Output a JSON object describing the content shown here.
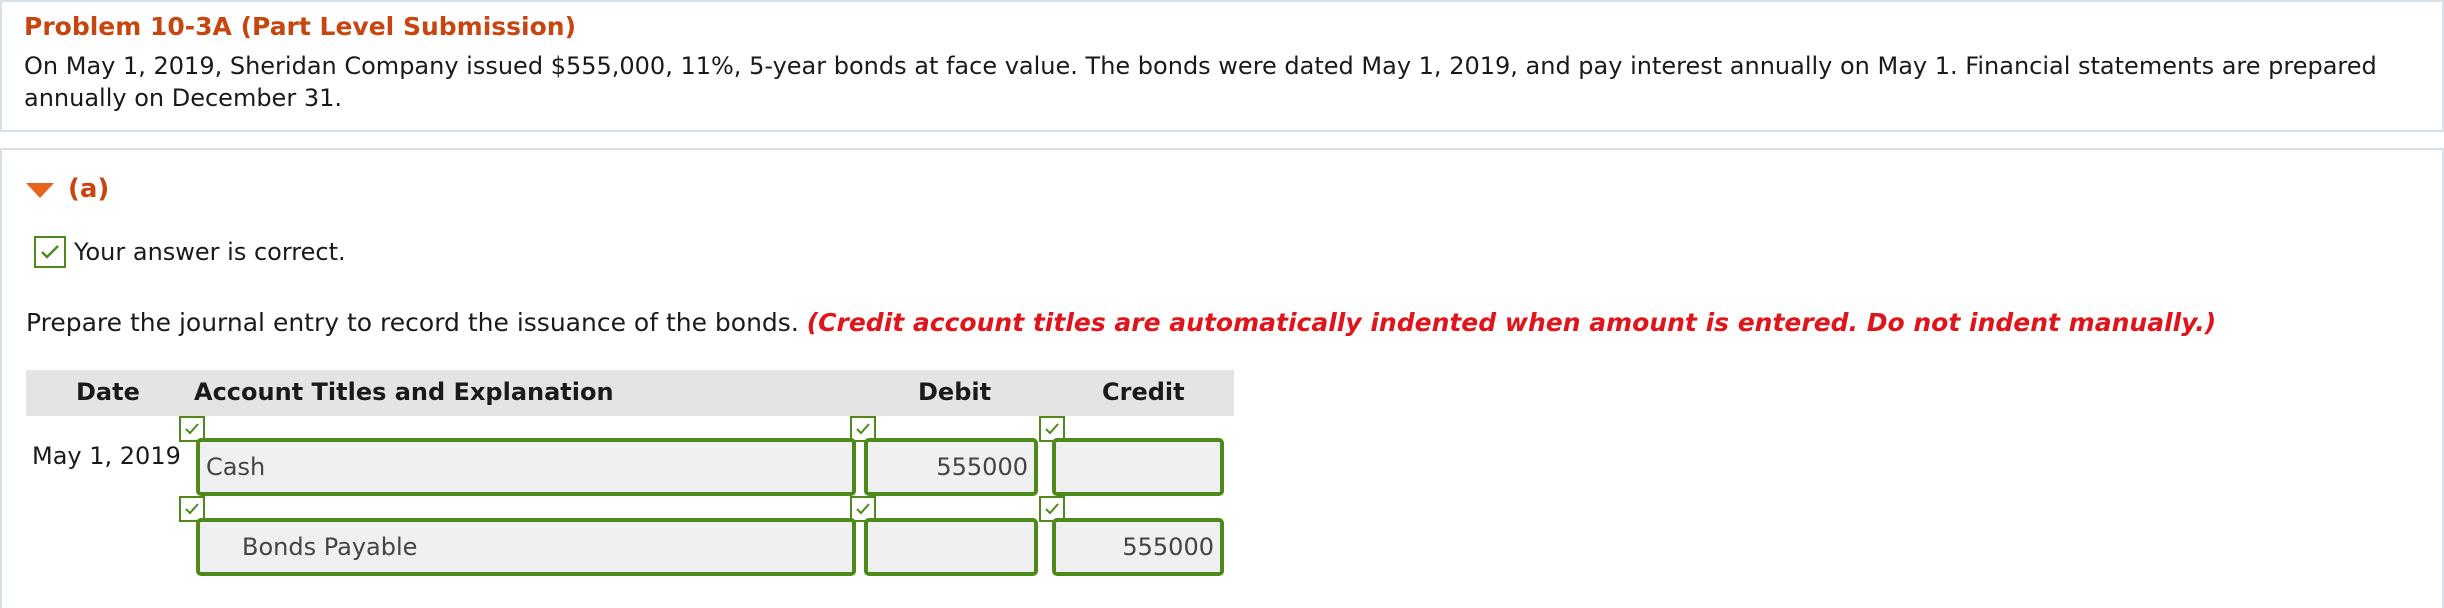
{
  "problem": {
    "title": "Problem 10-3A (Part Level Submission)",
    "text": "On May 1, 2019, Sheridan Company issued $555,000, 11%, 5-year bonds at face value. The bonds were dated May 1, 2019, and pay interest annually on May 1. Financial statements are prepared annually on December 31."
  },
  "part": {
    "label": "(a)",
    "status": "Your answer is correct.",
    "instruction": "Prepare the journal entry to record the issuance of the bonds.",
    "note": "(Credit account titles are automatically indented when amount is entered. Do not indent manually.)"
  },
  "journal": {
    "headers": {
      "date": "Date",
      "account": "Account Titles and Explanation",
      "debit": "Debit",
      "credit": "Credit"
    },
    "rows": [
      {
        "date": "May 1, 2019",
        "account": "Cash",
        "debit": "555000",
        "credit": ""
      },
      {
        "date": "",
        "account": "Bonds Payable",
        "debit": "",
        "credit": "555000"
      }
    ]
  },
  "colors": {
    "accent": "#c7450f",
    "correct": "#4d8a1a",
    "note": "#e0151b"
  },
  "icons": {
    "collapse": "triangle-down-icon",
    "check": "checkmark-icon"
  }
}
